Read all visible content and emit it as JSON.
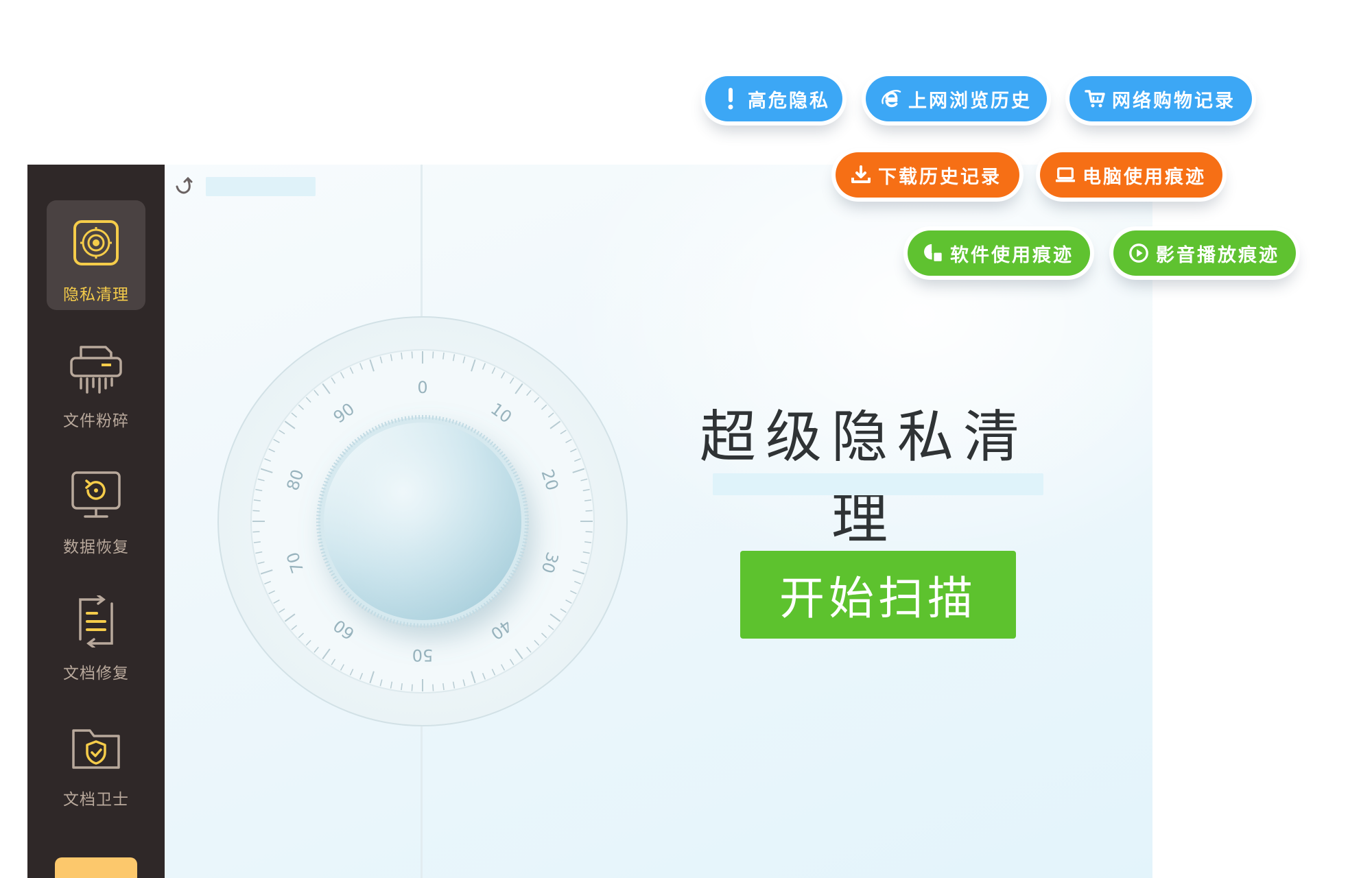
{
  "sidebar": {
    "items": [
      {
        "label": "隐私清理",
        "icon": "privacy-safe-icon",
        "active": true
      },
      {
        "label": "文件粉碎",
        "icon": "shredder-icon",
        "active": false
      },
      {
        "label": "数据恢复",
        "icon": "data-recovery-icon",
        "active": false
      },
      {
        "label": "文档修复",
        "icon": "document-repair-icon",
        "active": false
      },
      {
        "label": "文档卫士",
        "icon": "document-guard-icon",
        "active": false
      }
    ]
  },
  "main": {
    "title": "超级隐私清理",
    "scan_button": "开始扫描",
    "dial_numbers": [
      "0",
      "10",
      "20",
      "30",
      "40",
      "50",
      "60",
      "70",
      "80",
      "90"
    ]
  },
  "tags": [
    {
      "label": "高危隐私",
      "icon": "exclamation-icon",
      "color": "#3ca7f5"
    },
    {
      "label": "上网浏览历史",
      "icon": "browser-e-icon",
      "color": "#3ca7f5"
    },
    {
      "label": "网络购物记录",
      "icon": "shopping-cart-icon",
      "color": "#3ca7f5"
    },
    {
      "label": "下载历史记录",
      "icon": "download-icon",
      "color": "#f66f15"
    },
    {
      "label": "电脑使用痕迹",
      "icon": "laptop-icon",
      "color": "#f66f15"
    },
    {
      "label": "软件使用痕迹",
      "icon": "software-icon",
      "color": "#5fc230"
    },
    {
      "label": "影音播放痕迹",
      "icon": "play-icon",
      "color": "#5fc230"
    }
  ],
  "colors": {
    "sidebar_bg": "#2f2828",
    "accent_yellow": "#f5cc4a",
    "scan_green": "#5dc22e",
    "tag_blue": "#3ca7f5",
    "tag_orange": "#f66f15",
    "tag_green": "#5fc230"
  }
}
